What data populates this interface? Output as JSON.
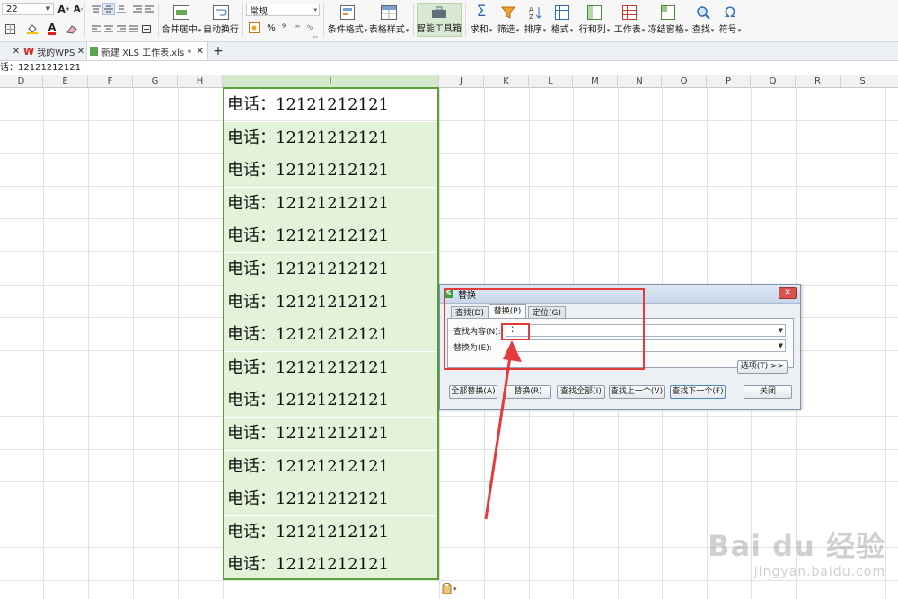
{
  "ribbon": {
    "font_size": "22",
    "number_format": "常规",
    "merge_center": "合并居中",
    "auto_wrap": "自动换行",
    "conditional_format": "条件格式",
    "table_style": "表格样式",
    "smart_toolbox": "智能工具箱",
    "sum": "求和",
    "filter": "筛选",
    "sort": "排序",
    "format": "格式",
    "row_col": "行和列",
    "worksheet": "工作表",
    "freeze": "冻结窗格",
    "find": "查找",
    "symbol": "符号",
    "percent": "%",
    "comma": "⁹"
  },
  "tabs": [
    {
      "label": "我的WPS"
    },
    {
      "label": "新建 XLS 工作表.xls *"
    }
  ],
  "formula_bar": {
    "content": "话：12121212121"
  },
  "columns": [
    "D",
    "E",
    "F",
    "G",
    "H",
    "I",
    "J",
    "K",
    "L",
    "M",
    "N",
    "O",
    "P",
    "Q",
    "R",
    "S"
  ],
  "cells": {
    "values": [
      "电话：12121212121",
      "电话：12121212121",
      "电话：12121212121",
      "电话：12121212121",
      "电话：12121212121",
      "电话：12121212121",
      "电话：12121212121",
      "电话：12121212121",
      "电话：12121212121",
      "电话：12121212121",
      "电话：12121212121",
      "电话：12121212121",
      "电话：12121212121",
      "电话：12121212121",
      "电话：12121212121"
    ]
  },
  "dialog": {
    "title": "替换",
    "tabs": [
      "查找(D)",
      "替换(P)",
      "定位(G)"
    ],
    "find_label": "查找内容(N):",
    "find_value": "：",
    "replace_label": "替换为(E):",
    "replace_value": "",
    "options_button": "选项(T) >>",
    "buttons": [
      "全部替换(A)",
      "替换(R)",
      "查找全部(I)",
      "查找上一个(V)",
      "查找下一个(F)",
      "关闭"
    ]
  },
  "watermark": {
    "brand": "Bai du 经验",
    "url": "jingyan.baidu.com"
  },
  "colors": {
    "selection_border": "#5a9e3d",
    "selection_fill": "#e2f3da",
    "annotation": "#e33b3b"
  }
}
